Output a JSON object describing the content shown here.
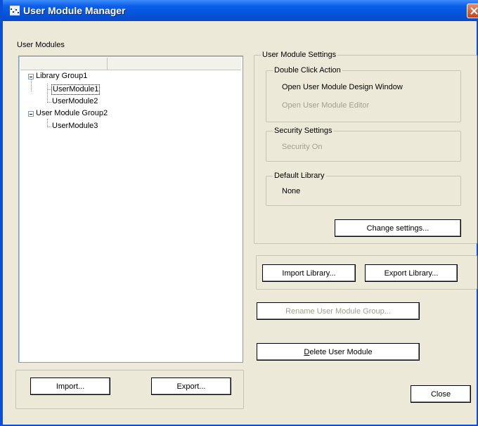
{
  "window": {
    "title": "User Module Manager"
  },
  "left": {
    "section_label": "User Modules",
    "tree": {
      "groups": [
        {
          "label": "Library Group1",
          "children": [
            "UserModule1",
            "UserModule2"
          ]
        },
        {
          "label": "User Module Group2",
          "children": [
            "UserModule3"
          ]
        }
      ]
    },
    "buttons": {
      "import": "Import...",
      "export": "Export..."
    }
  },
  "settings": {
    "title": "User Module Settings",
    "double_click": {
      "title": "Double Click Action",
      "option_active": "Open User Module Design Window",
      "option_inactive": "Open User Module Editor"
    },
    "security": {
      "title": "Security Settings",
      "value": "Security  On"
    },
    "default_library": {
      "title": "Default Library",
      "value": "None"
    },
    "change_button": "Change settings..."
  },
  "library_buttons": {
    "import": "Import Library...",
    "export": "Export Library..."
  },
  "rename_button": "Rename User Module Group...",
  "delete_button": "Delete User Module",
  "close_button": "Close"
}
